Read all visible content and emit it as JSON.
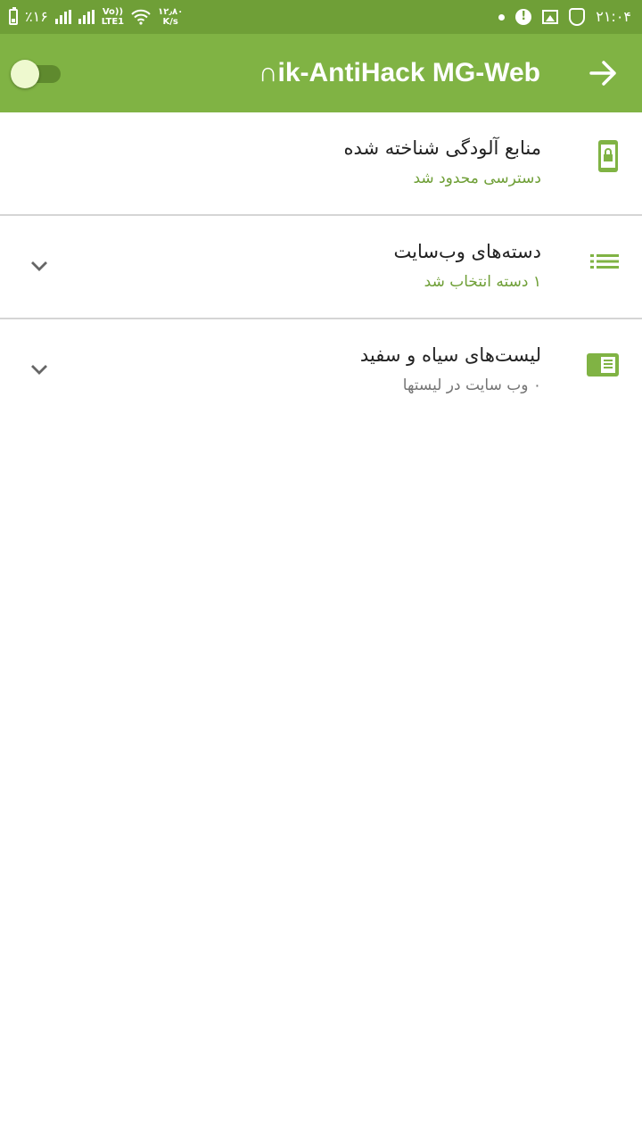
{
  "status_bar": {
    "battery_percent": "٪۱۶",
    "volte_label": "Vo))\nLTE1",
    "network_speed_value": "۱۲٫۸۰",
    "network_speed_unit": "K/s",
    "time": "۲۱:۰۴",
    "icons": [
      "battery-icon",
      "signal-icon",
      "signal-icon",
      "volte-icon",
      "wifi-icon",
      "dot-icon",
      "alert-icon",
      "image-icon",
      "shield-icon"
    ]
  },
  "app_bar": {
    "title": "∩ik-AntiHack MG-Web",
    "toggle_on": false,
    "forward_icon": "arrow-right-icon"
  },
  "rows": [
    {
      "title": "منابع آلودگی شناخته شده",
      "subtitle": "دسترسی محدود شد",
      "subtitle_color": "#6f9f37",
      "icon": "phone-lock-icon",
      "expandable": false
    },
    {
      "title": "دسته‌های وب‌سایت",
      "subtitle": "۱ دسته انتخاب شد",
      "subtitle_color": "#6f9f37",
      "icon": "list-icon",
      "expandable": true
    },
    {
      "title": "لیست‌های سیاه و سفید",
      "subtitle": "۰ وب سایت در لیستها",
      "subtitle_color": "#757575",
      "icon": "blacklist-icon",
      "expandable": true
    }
  ],
  "colors": {
    "status_bar": "#6f9f37",
    "app_bar": "#80b344",
    "accent": "#6f9f37"
  }
}
